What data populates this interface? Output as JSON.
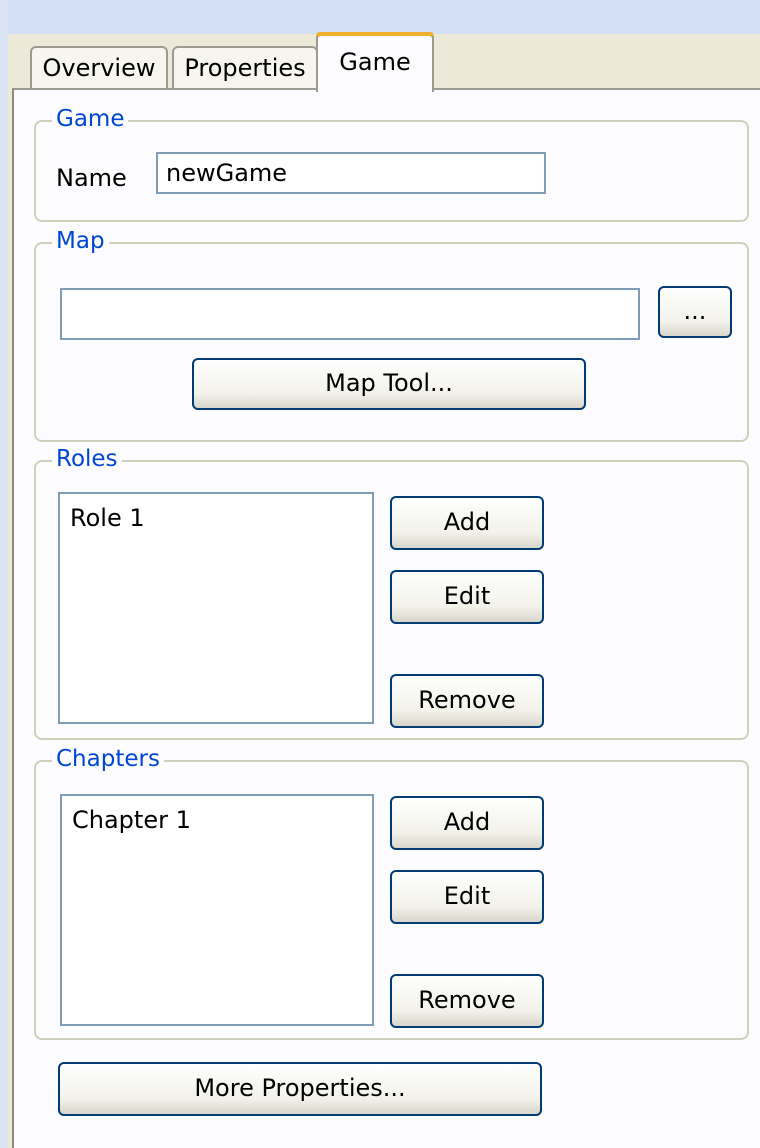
{
  "tabs": [
    {
      "label": "Overview"
    },
    {
      "label": "Properties"
    },
    {
      "label": "Game",
      "active": true
    }
  ],
  "game_group": {
    "title": "Game",
    "name_label": "Name",
    "name_value": "newGame"
  },
  "map_group": {
    "title": "Map",
    "path_value": "",
    "browse_label": "...",
    "map_tool_label": "Map Tool..."
  },
  "roles_group": {
    "title": "Roles",
    "items": [
      "Role 1"
    ],
    "add_label": "Add",
    "edit_label": "Edit",
    "remove_label": "Remove"
  },
  "chapters_group": {
    "title": "Chapters",
    "items": [
      "Chapter 1"
    ],
    "add_label": "Add",
    "edit_label": "Edit",
    "remove_label": "Remove"
  },
  "more_properties_label": "More Properties...",
  "colors": {
    "accent": "#0046d5",
    "active_tab_highlight": "#f0a018",
    "button_border": "#003c74",
    "textbox_border": "#7f9db9"
  }
}
